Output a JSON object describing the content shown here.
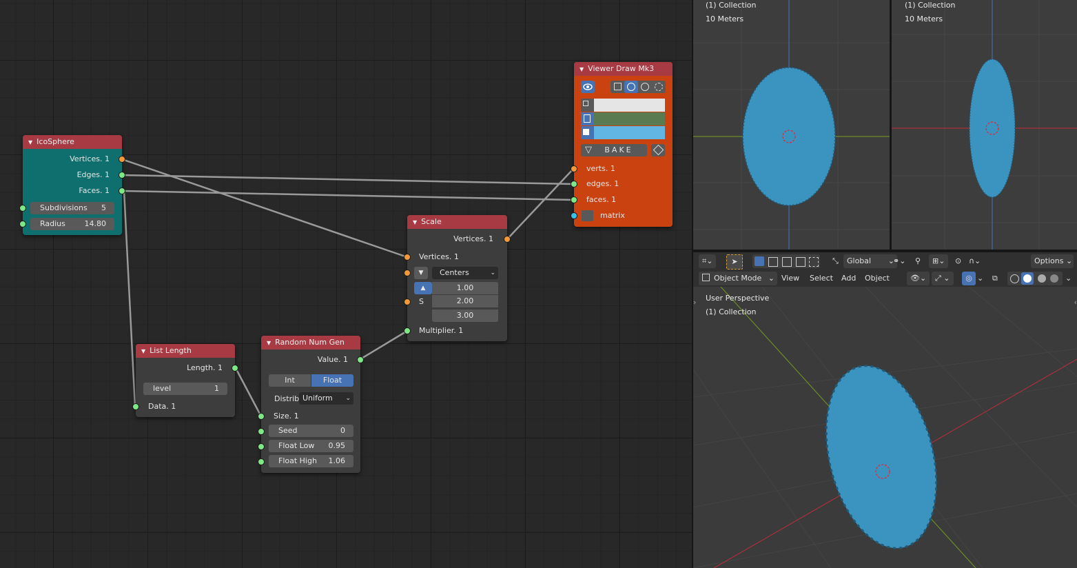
{
  "node_editor": {
    "icosphere": {
      "title": "IcoSphere",
      "outputs": [
        "Vertices. 1",
        "Edges. 1",
        "Faces. 1"
      ],
      "fields": [
        {
          "label": "Subdivisions",
          "value": "5"
        },
        {
          "label": "Radius",
          "value": "14.80"
        }
      ]
    },
    "list_length": {
      "title": "List Length",
      "output": "Length. 1",
      "level_label": "level",
      "level_value": "1",
      "input": "Data. 1"
    },
    "random_num_gen": {
      "title": "Random Num Gen",
      "output": "Value. 1",
      "mode_int": "Int",
      "mode_float": "Float",
      "distrib_label": "Distrib",
      "distrib_value": "Uniform",
      "size_input": "Size. 1",
      "fields": [
        {
          "label": "Seed",
          "value": "0"
        },
        {
          "label": "Float Low",
          "value": "0.95"
        },
        {
          "label": "Float High",
          "value": "1.06"
        }
      ]
    },
    "scale": {
      "title": "Scale",
      "output": "Vertices. 1",
      "input_vertices": "Vertices. 1",
      "centers_value": "Centers",
      "s_label": "S",
      "vector": [
        "1.00",
        "2.00",
        "3.00"
      ],
      "multiplier": "Multiplier. 1"
    },
    "viewer_draw": {
      "title": "Viewer Draw Mk3",
      "bake_label": "BAKE",
      "colors": {
        "verts": "#e5e5e5",
        "edges": "#5a7a52",
        "faces": "#62b6e3"
      },
      "inputs": [
        "verts. 1",
        "edges. 1",
        "faces. 1",
        "matrix"
      ]
    }
  },
  "viewport_left": {
    "collection": "(1) Collection",
    "scale": "10 Meters"
  },
  "viewport_right": {
    "collection": "(1) Collection",
    "scale": "10 Meters"
  },
  "header": {
    "transform_orientation": "Global",
    "options": "Options",
    "mode": "Object Mode",
    "menu": [
      "View",
      "Select",
      "Add",
      "Object"
    ]
  },
  "viewport_main": {
    "view_name": "User Perspective",
    "collection": "(1) Collection"
  },
  "colors": {
    "node_header": "#a83a43",
    "icosphere_body": "#0f6e6e",
    "viewer_body": "#c9420f",
    "mesh": "#3b93c0",
    "accent": "#4772b3"
  }
}
